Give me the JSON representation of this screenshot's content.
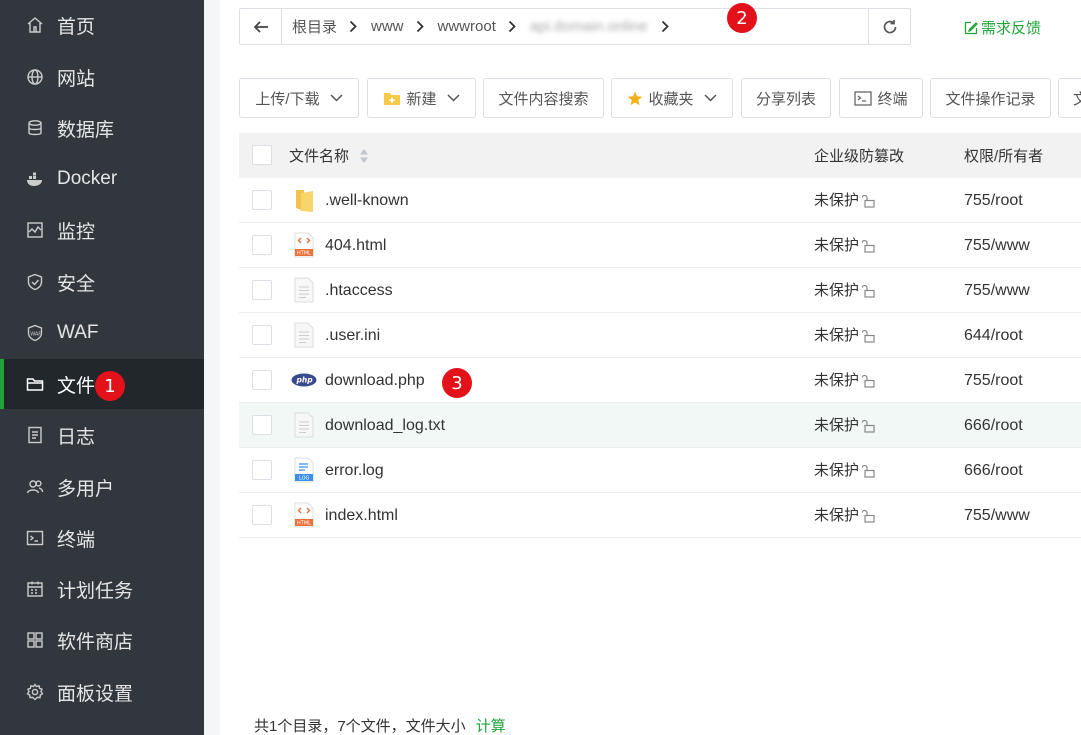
{
  "sidebar": {
    "items": [
      {
        "label": "首页",
        "icon": "home-icon"
      },
      {
        "label": "网站",
        "icon": "globe-icon"
      },
      {
        "label": "数据库",
        "icon": "database-icon"
      },
      {
        "label": "Docker",
        "icon": "docker-icon"
      },
      {
        "label": "监控",
        "icon": "monitor-icon"
      },
      {
        "label": "安全",
        "icon": "shield-icon"
      },
      {
        "label": "WAF",
        "icon": "waf-icon"
      },
      {
        "label": "文件",
        "icon": "folder-icon"
      },
      {
        "label": "日志",
        "icon": "log-icon"
      },
      {
        "label": "多用户",
        "icon": "users-icon"
      },
      {
        "label": "终端",
        "icon": "terminal-icon"
      },
      {
        "label": "计划任务",
        "icon": "calendar-icon"
      },
      {
        "label": "软件商店",
        "icon": "apps-icon"
      },
      {
        "label": "面板设置",
        "icon": "gear-icon"
      }
    ],
    "active_index": 7
  },
  "badges": [
    "1",
    "2",
    "3"
  ],
  "path": {
    "crumbs": [
      "根目录",
      "www",
      "wwwroot"
    ],
    "last_blurred": "api.domain.online"
  },
  "feedback": "需求反馈",
  "toolbar": {
    "upload": "上传/下载",
    "new": "新建",
    "search_content": "文件内容搜索",
    "favorites": "收藏夹",
    "share_list": "分享列表",
    "terminal": "终端",
    "op_log": "文件操作记录",
    "overflow": "文"
  },
  "table": {
    "headers": {
      "name": "文件名称",
      "protect": "企业级防篡改",
      "perm": "权限/所有者"
    },
    "rows": [
      {
        "name": ".well-known",
        "type": "folder",
        "protect": "未保护",
        "perm": "755/root"
      },
      {
        "name": "404.html",
        "type": "html",
        "protect": "未保护",
        "perm": "755/www"
      },
      {
        "name": ".htaccess",
        "type": "text",
        "protect": "未保护",
        "perm": "755/www"
      },
      {
        "name": ".user.ini",
        "type": "text",
        "protect": "未保护",
        "perm": "644/root"
      },
      {
        "name": "download.php",
        "type": "php",
        "protect": "未保护",
        "perm": "755/root"
      },
      {
        "name": "download_log.txt",
        "type": "txt",
        "protect": "未保护",
        "perm": "666/root"
      },
      {
        "name": "error.log",
        "type": "log",
        "protect": "未保护",
        "perm": "666/root"
      },
      {
        "name": "index.html",
        "type": "html",
        "protect": "未保护",
        "perm": "755/www"
      }
    ]
  },
  "footer": {
    "summary": "共1个目录，7个文件，文件大小",
    "calc": "计算"
  },
  "colors": {
    "accent": "#20a53a",
    "sidebar_bg": "#32373d",
    "badge": "#e3121a"
  }
}
